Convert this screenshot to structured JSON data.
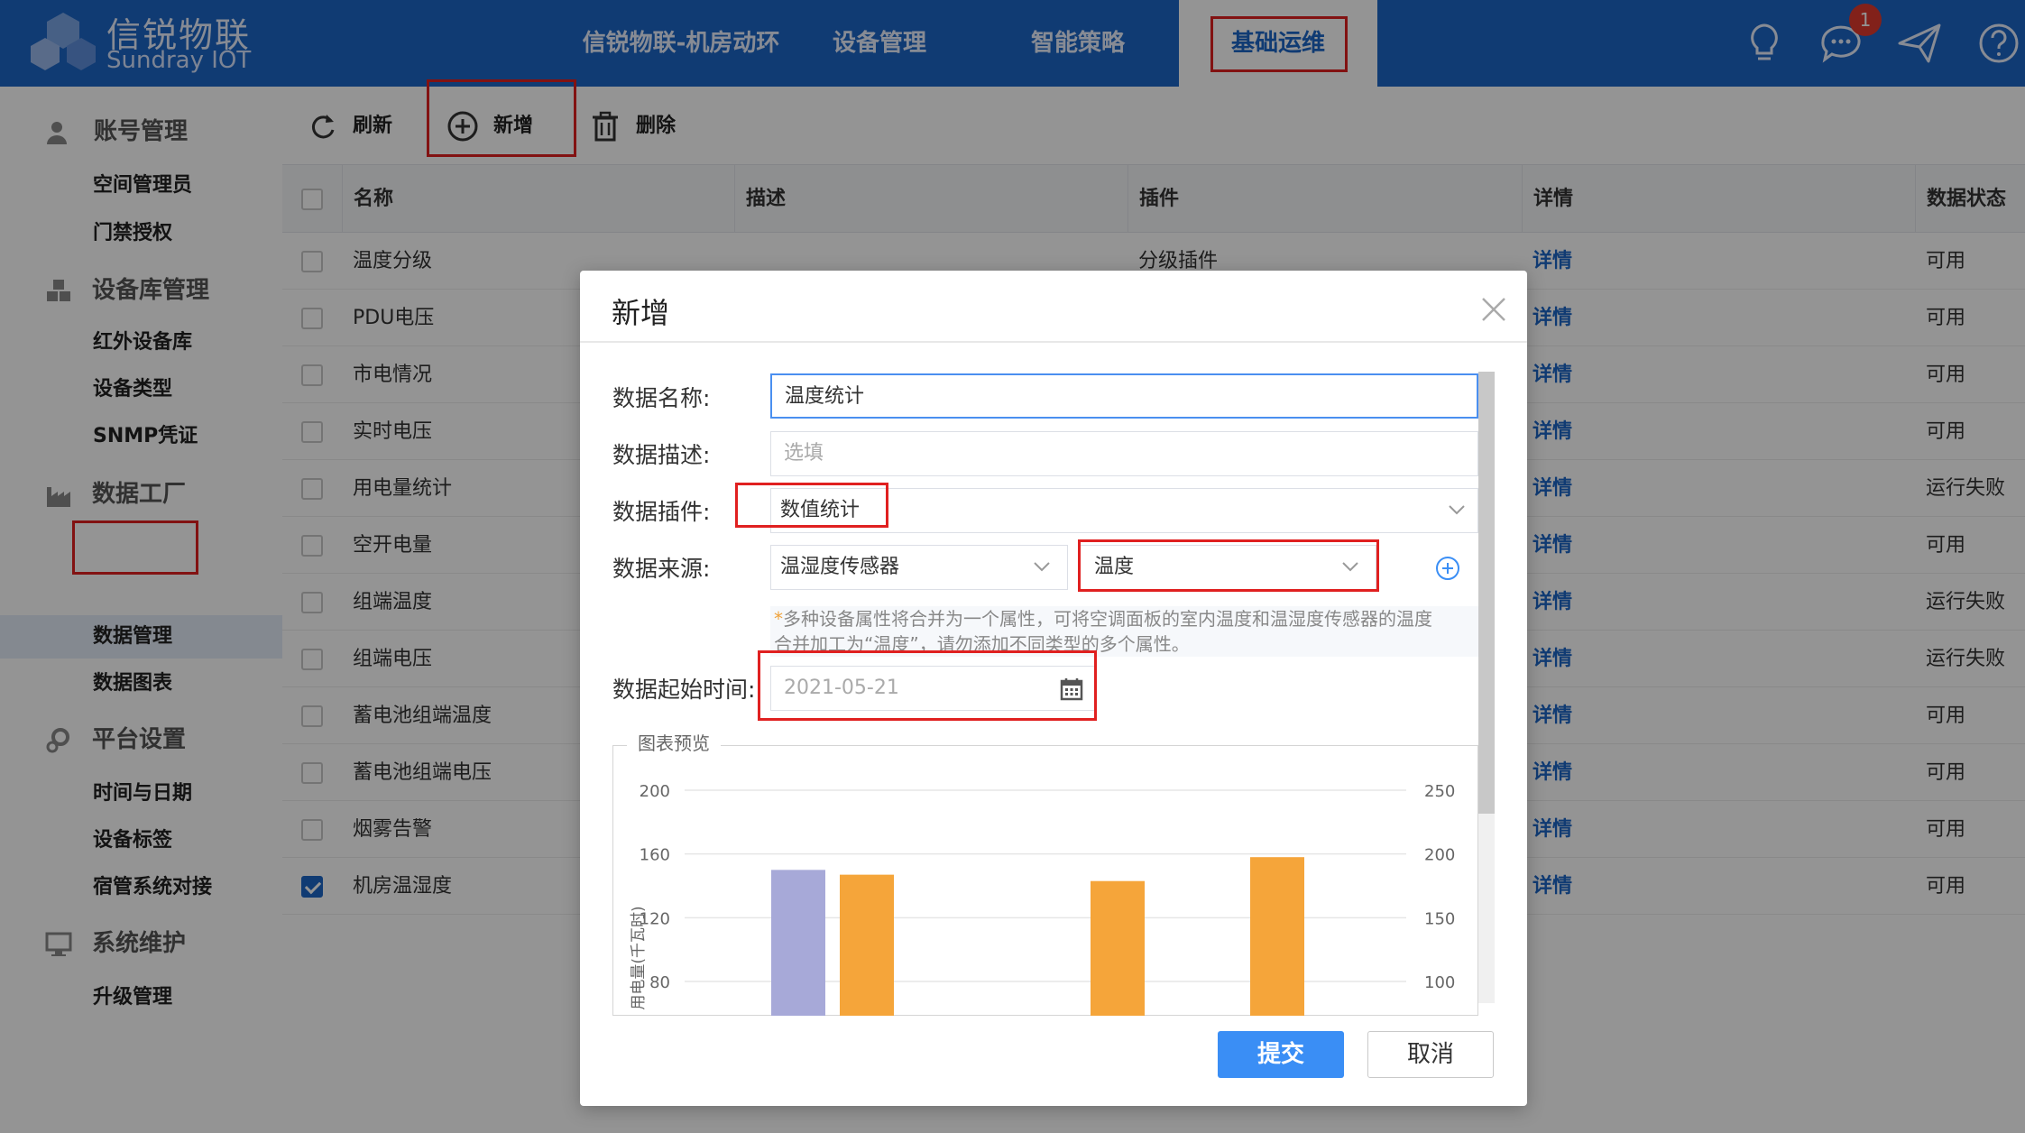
{
  "header": {
    "brand_cn": "信锐物联",
    "brand_en": "Sundray IOT",
    "nav": [
      {
        "label": "信锐物联-机房动环"
      },
      {
        "label": "设备管理"
      },
      {
        "label": "智能策略"
      },
      {
        "label": "基础运维",
        "active": true
      }
    ],
    "notification_count": "1",
    "icons": [
      "lightbulb-icon",
      "chat-icon",
      "send-icon",
      "help-icon"
    ]
  },
  "sidebar": {
    "groups": [
      {
        "title": "账号管理",
        "icon": "user-icon",
        "items": [
          "空间管理员",
          "门禁授权"
        ]
      },
      {
        "title": "设备库管理",
        "icon": "cubes-icon",
        "items": [
          "红外设备库",
          "设备类型",
          "SNMP凭证"
        ]
      },
      {
        "title": "数据工厂",
        "icon": "factory-icon",
        "items": [
          "数据管理",
          "数据图表"
        ]
      },
      {
        "title": "平台设置",
        "icon": "gears-icon",
        "items": [
          "时间与日期",
          "设备标签",
          "宿管系统对接"
        ]
      },
      {
        "title": "系统维护",
        "icon": "monitor-icon",
        "items": [
          "升级管理"
        ]
      }
    ],
    "active_item": "数据管理"
  },
  "toolbar": {
    "refresh_label": "刷新",
    "add_label": "新增",
    "delete_label": "删除"
  },
  "table": {
    "columns": [
      "名称",
      "描述",
      "插件",
      "详情",
      "数据状态"
    ],
    "rows": [
      {
        "name": "温度分级",
        "desc": "",
        "plugin": "分级插件",
        "detail": "详情",
        "status": "可用",
        "checked": false
      },
      {
        "name": "PDU电压",
        "desc": "",
        "plugin": "",
        "detail": "详情",
        "status": "可用",
        "checked": false
      },
      {
        "name": "市电情况",
        "desc": "",
        "plugin": "",
        "detail": "详情",
        "status": "可用",
        "checked": false
      },
      {
        "name": "实时电压",
        "desc": "",
        "plugin": "",
        "detail": "详情",
        "status": "可用",
        "checked": false
      },
      {
        "name": "用电量统计",
        "desc": "",
        "plugin": "",
        "detail": "详情",
        "status": "运行失败",
        "checked": false
      },
      {
        "name": "空开电量",
        "desc": "",
        "plugin": "",
        "detail": "详情",
        "status": "可用",
        "checked": false
      },
      {
        "name": "组端温度",
        "desc": "",
        "plugin": "",
        "detail": "详情",
        "status": "运行失败",
        "checked": false
      },
      {
        "name": "组端电压",
        "desc": "",
        "plugin": "",
        "detail": "详情",
        "status": "运行失败",
        "checked": false
      },
      {
        "name": "蓄电池组端温度",
        "desc": "",
        "plugin": "",
        "detail": "详情",
        "status": "可用",
        "checked": false
      },
      {
        "name": "蓄电池组端电压",
        "desc": "",
        "plugin": "",
        "detail": "详情",
        "status": "可用",
        "checked": false
      },
      {
        "name": "烟雾告警",
        "desc": "",
        "plugin": "",
        "detail": "详情",
        "status": "可用",
        "checked": false
      },
      {
        "name": "机房温湿度",
        "desc": "",
        "plugin": "",
        "detail": "详情",
        "status": "可用",
        "checked": true
      }
    ]
  },
  "modal": {
    "title": "新增",
    "fields": {
      "name_label": "数据名称:",
      "name_value": "温度统计",
      "desc_label": "数据描述:",
      "desc_placeholder": "选填",
      "plugin_label": "数据插件:",
      "plugin_value": "数值统计",
      "source_label": "数据来源:",
      "source_device": "温湿度传感器",
      "source_attr": "温度",
      "start_label": "数据起始时间:",
      "start_value": "2021-05-21"
    },
    "hint_star": "*",
    "hint_line1": "多种设备属性将合并为一个属性，可将空调面板的室内温度和温湿度传感器的温度",
    "hint_line2": "合并加工为“温度”，请勿添加不同类型的多个属性。",
    "preview_legend": "图表预览",
    "submit_label": "提交",
    "cancel_label": "取消"
  },
  "chart_data": {
    "type": "bar",
    "ylabel": "用电量(千瓦时)",
    "y_left_ticks": [
      200,
      160,
      120,
      80
    ],
    "y_right_ticks": [
      250,
      200,
      150,
      100
    ],
    "ylim_left": [
      80,
      200
    ],
    "ylim_right": [
      100,
      250
    ],
    "series": [
      {
        "color": "#a7a9d8",
        "values": [
          150,
          null,
          null,
          null
        ]
      },
      {
        "color": "#f5a53a",
        "values": [
          147,
          null,
          null,
          null
        ]
      },
      {
        "color": "#f5a53a",
        "values": [
          null,
          null,
          143,
          null
        ]
      },
      {
        "color": "#f5a53a",
        "values": [
          null,
          null,
          null,
          158
        ]
      }
    ]
  }
}
